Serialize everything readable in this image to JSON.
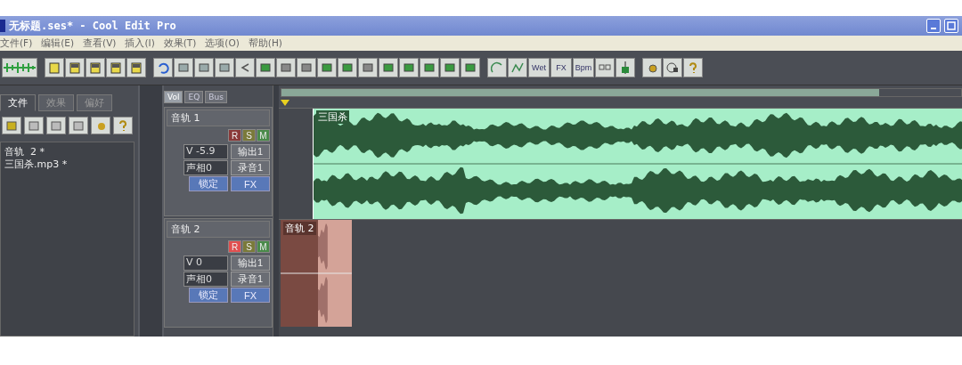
{
  "window": {
    "title": "无标题.ses* - Cool Edit Pro"
  },
  "menu": [
    "文件(F)",
    "编辑(E)",
    "查看(V)",
    "插入(I)",
    "效果(T)",
    "选项(O)",
    "帮助(H)"
  ],
  "toolbar_text_buttons": [
    "Wet",
    "FX",
    "Bpm"
  ],
  "side_tabs": [
    {
      "label": "文件",
      "selected": true
    },
    {
      "label": "效果",
      "selected": false
    },
    {
      "label": "偏好",
      "selected": false
    }
  ],
  "file_list": [
    {
      "name": "音轨  2 *"
    },
    {
      "name": "三国杀.mp3 *"
    }
  ],
  "mixer_tabs": [
    {
      "label": "Vol",
      "selected": true
    },
    {
      "label": "EQ",
      "selected": false
    },
    {
      "label": "Bus",
      "selected": false
    }
  ],
  "tracks": [
    {
      "name": "音轨 1",
      "record": false,
      "solo": false,
      "mute": false,
      "volume": "V -5.9",
      "pan": "声相0",
      "output": "输出1",
      "input": "录音1",
      "lock": "锁定",
      "fx": "FX",
      "clip_label": "三国杀",
      "kind": "stereo",
      "rsm": [
        "R",
        "S",
        "M"
      ]
    },
    {
      "name": "音轨 2",
      "record": true,
      "solo": false,
      "mute": false,
      "volume": "V 0",
      "pan": "声相0",
      "output": "输出1",
      "input": "录音1",
      "lock": "锁定",
      "fx": "FX",
      "clip_label": "音轨 2",
      "kind": "record",
      "rsm": [
        "R",
        "S",
        "M"
      ]
    }
  ]
}
